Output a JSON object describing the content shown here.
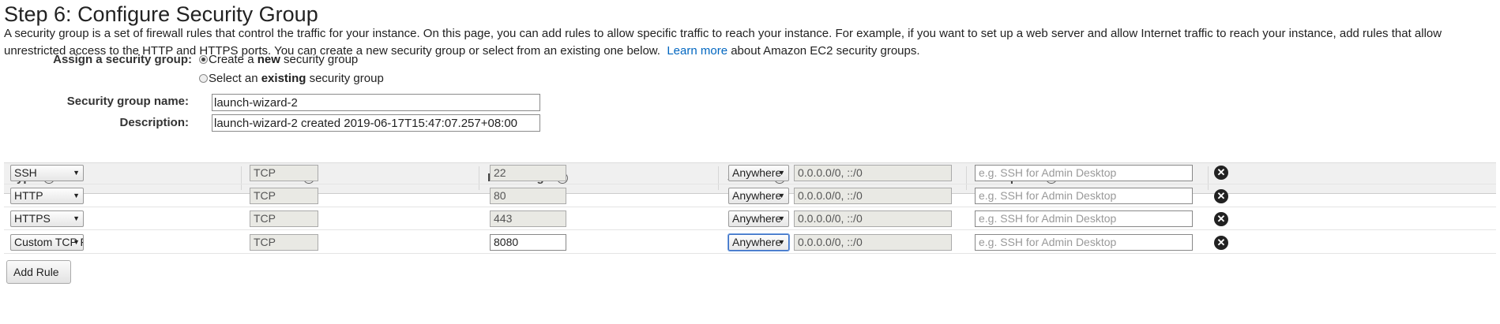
{
  "page": {
    "title": "Step 6: Configure Security Group",
    "intro_text": "A security group is a set of firewall rules that control the traffic for your instance. On this page, you can add rules to allow specific traffic to reach your instance. For example, if you want to set up a web server and allow Internet traffic to reach your instance, add rules that allow unrestricted access to the HTTP and HTTPS ports. You can create a new security group or select from an existing one below.",
    "learn_more_link": "Learn more",
    "intro_suffix": "about Amazon EC2 security groups."
  },
  "assign": {
    "label": "Assign a security group:",
    "opt_new_prefix": "Create a ",
    "opt_new_bold": "new",
    "opt_new_suffix": " security group",
    "opt_existing_prefix": "Select an ",
    "opt_existing_bold": "existing",
    "opt_existing_suffix": " security group"
  },
  "group_form": {
    "name_label": "Security group name:",
    "name_value": "launch-wizard-2",
    "description_label": "Description:",
    "description_value": "launch-wizard-2 created 2019-06-17T15:47:07.257+08:00"
  },
  "table": {
    "headers": {
      "type": "Type",
      "protocol": "Protocol",
      "port_range": "Port Range",
      "source": "Source",
      "description": "Description"
    },
    "info_glyph": "i",
    "rows": [
      {
        "type": "SSH",
        "protocol": "TCP",
        "port": "22",
        "source": "Anywhere",
        "cidr": "0.0.0.0/0, ::/0",
        "desc_placeholder": "e.g. SSH for Admin Desktop"
      },
      {
        "type": "HTTP",
        "protocol": "TCP",
        "port": "80",
        "source": "Anywhere",
        "cidr": "0.0.0.0/0, ::/0",
        "desc_placeholder": "e.g. SSH for Admin Desktop"
      },
      {
        "type": "HTTPS",
        "protocol": "TCP",
        "port": "443",
        "source": "Anywhere",
        "cidr": "0.0.0.0/0, ::/0",
        "desc_placeholder": "e.g. SSH for Admin Desktop"
      },
      {
        "type": "Custom TCP F",
        "protocol": "TCP",
        "port": "8080",
        "source": "Anywhere",
        "cidr": "0.0.0.0/0, ::/0",
        "desc_placeholder": "e.g. SSH for Admin Desktop"
      }
    ],
    "delete_glyph": "✕",
    "dropdown_arrow": "▼"
  },
  "add_rule": {
    "label": "Add Rule"
  },
  "icons": {
    "info": "info-icon",
    "delete": "close-circle-icon",
    "dropdown": "chevron-down-icon"
  },
  "colors": {
    "link": "#0066c0",
    "header_bg": "#f0f0f0"
  }
}
